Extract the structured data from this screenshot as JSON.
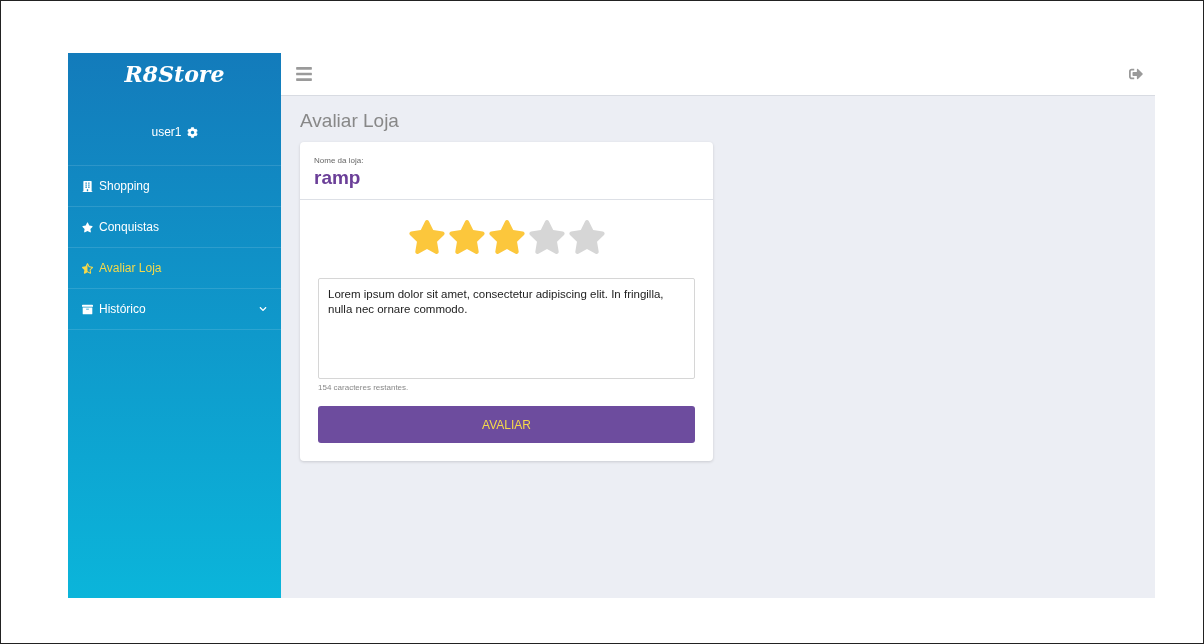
{
  "brand": {
    "logo": "R8Store"
  },
  "user": {
    "name": "user1"
  },
  "sidebar": {
    "items": [
      {
        "label": "Shopping",
        "selected": false
      },
      {
        "label": "Conquistas",
        "selected": false
      },
      {
        "label": "Avaliar Loja",
        "selected": true
      },
      {
        "label": "Histórico",
        "selected": false,
        "expanded": false
      }
    ]
  },
  "page": {
    "title": "Avaliar Loja"
  },
  "card": {
    "store_label": "Nome da loja:",
    "store_name": "ramp",
    "stars": 3,
    "review": "Lorem ipsum dolor sit amet, consectetur adipiscing elit. In fringilla, nulla nec ornare commodo.",
    "counter": "154 caracteres restantes.",
    "button": "AVALIAR"
  }
}
